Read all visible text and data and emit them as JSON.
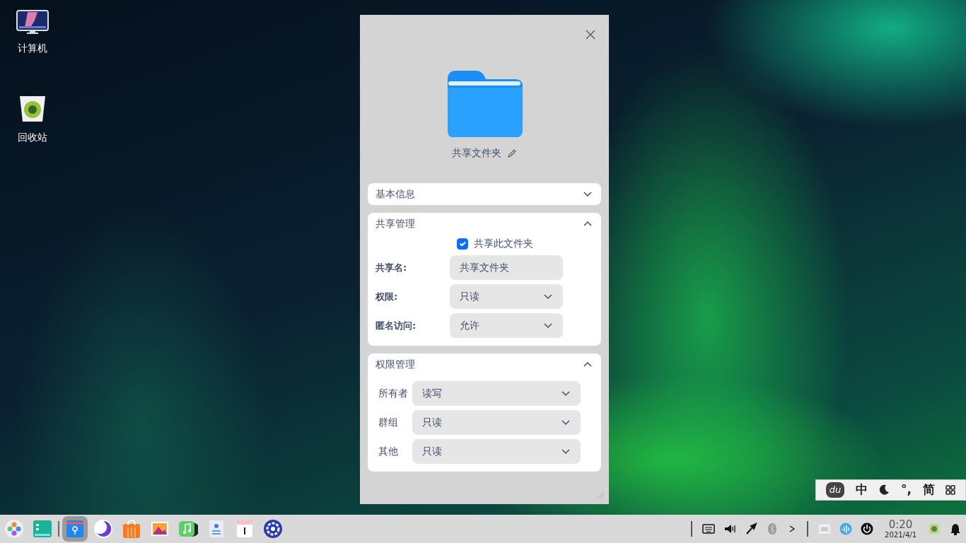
{
  "desktop_icons": [
    {
      "kind": "computer",
      "label": "计算机"
    },
    {
      "kind": "trash",
      "label": "回收站"
    }
  ],
  "dialog": {
    "folder_name": "共享文件夹",
    "sections": [
      {
        "title": "基本信息",
        "expanded": false
      },
      {
        "kind": "share",
        "title": "共享管理",
        "expanded": true,
        "share_checkbox": {
          "label": "共享此文件夹",
          "checked": true
        },
        "fields": [
          {
            "kind": "text",
            "label": "共享名:",
            "value": "共享文件夹"
          },
          {
            "kind": "select",
            "label": "权限:",
            "value": "只读"
          },
          {
            "kind": "select",
            "label": "匿名访问:",
            "value": "允许"
          }
        ]
      },
      {
        "kind": "permissions",
        "title": "权限管理",
        "expanded": true,
        "fields": [
          {
            "kind": "select",
            "label": "所有者",
            "value": "读写"
          },
          {
            "kind": "select",
            "label": "群组",
            "value": "只读"
          },
          {
            "kind": "select",
            "label": "其他",
            "value": "只读"
          }
        ]
      }
    ]
  },
  "ime_bar": {
    "logo": "du",
    "mode": "中",
    "punctuation": "°,",
    "script": "简"
  },
  "taskbar": {
    "apps": [
      {
        "kind": "launcher",
        "selected": false
      },
      {
        "kind": "multitask",
        "selected": false
      },
      {
        "kind": "files",
        "selected": true
      },
      {
        "kind": "browser",
        "selected": false
      },
      {
        "kind": "store",
        "selected": false
      },
      {
        "kind": "photos",
        "selected": false
      },
      {
        "kind": "music",
        "selected": false
      },
      {
        "kind": "contacts",
        "selected": false
      },
      {
        "kind": "calendar",
        "selected": false
      },
      {
        "kind": "settings",
        "selected": false
      }
    ],
    "clock": {
      "time": "0:20",
      "date": "2021/4/1"
    }
  }
}
